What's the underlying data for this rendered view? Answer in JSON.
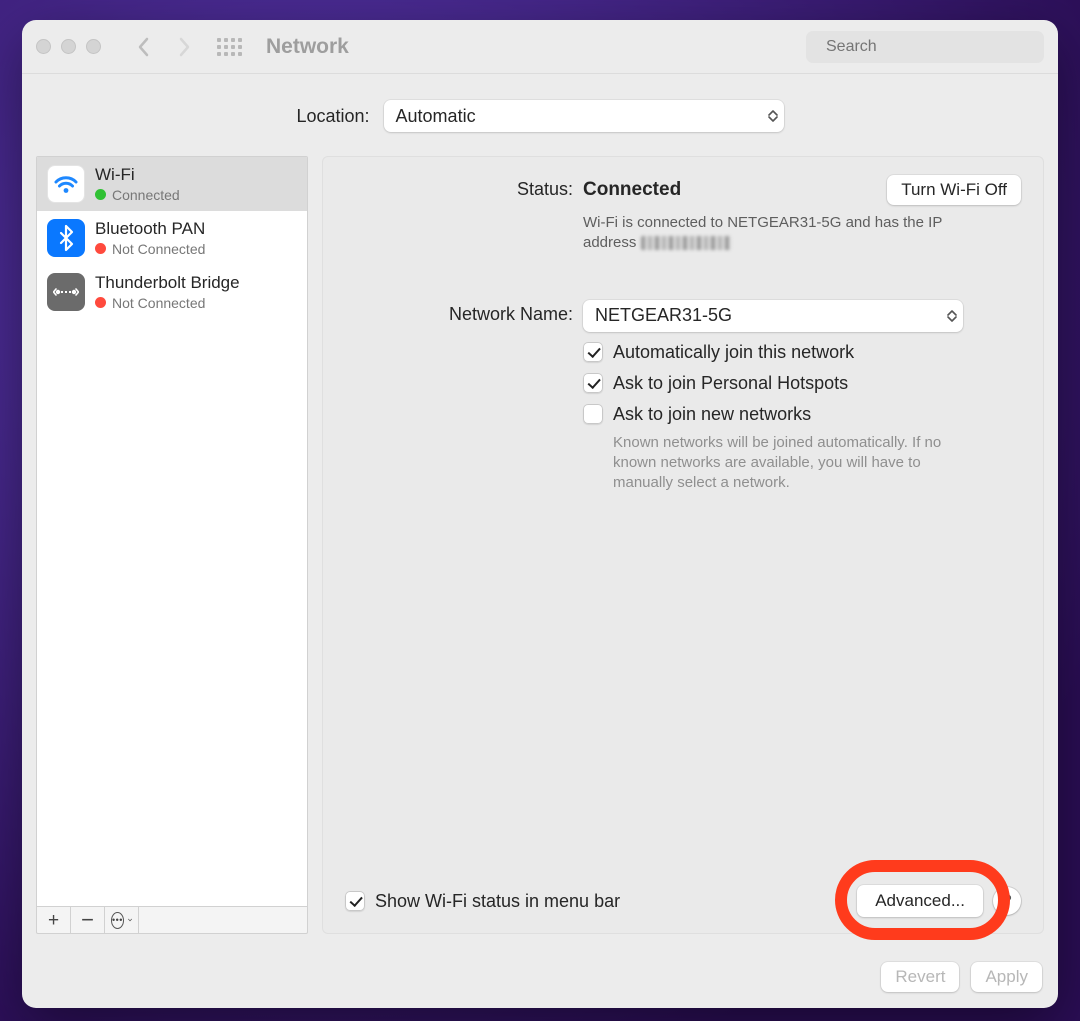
{
  "title": "Network",
  "search": {
    "placeholder": "Search"
  },
  "location": {
    "label": "Location:",
    "value": "Automatic"
  },
  "sidebar": {
    "items": [
      {
        "name": "Wi-Fi",
        "status": "Connected",
        "kind": "wifi",
        "dot": "green",
        "active": true
      },
      {
        "name": "Bluetooth PAN",
        "status": "Not Connected",
        "kind": "bluetooth",
        "dot": "red",
        "active": false
      },
      {
        "name": "Thunderbolt Bridge",
        "status": "Not Connected",
        "kind": "thunderbolt",
        "dot": "red",
        "active": false
      }
    ]
  },
  "detail": {
    "status_label": "Status:",
    "status_value": "Connected",
    "toggle_label": "Turn Wi-Fi Off",
    "status_sub_pre": "Wi-Fi is connected to NETGEAR31-5G and has the IP address ",
    "name_label": "Network Name:",
    "name_value": "NETGEAR31-5G",
    "opt_auto_join": "Automatically join this network",
    "opt_ask_hotspot": "Ask to join Personal Hotspots",
    "opt_ask_new": "Ask to join new networks",
    "opt_ask_new_help": "Known networks will be joined automatically. If no known networks are available, you will have to manually select a network.",
    "auto_join_checked": true,
    "ask_hotspot_checked": true,
    "ask_new_checked": false,
    "menubar_label": "Show Wi-Fi status in menu bar",
    "menubar_checked": true,
    "advanced_label": "Advanced...",
    "help_label": "?"
  },
  "footer": {
    "revert": "Revert",
    "apply": "Apply"
  }
}
